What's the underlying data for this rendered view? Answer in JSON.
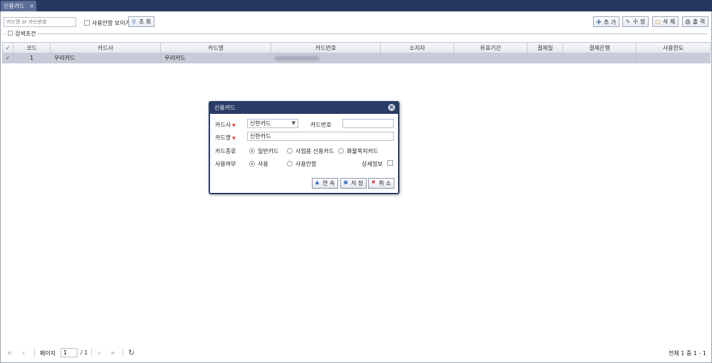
{
  "tab": {
    "label": "신용카드",
    "close": "×"
  },
  "toolbar": {
    "search_placeholder": "카드명 or 카드번호",
    "show_unused_label": "사용안함 보이기",
    "search_button": "조 회",
    "add_button": "추 가",
    "edit_button": "수 정",
    "delete_button": "삭 제",
    "print_button": "출 력"
  },
  "search_conditions": {
    "label": "검색조건"
  },
  "grid": {
    "columns": [
      "코드",
      "카드사",
      "카드명",
      "카드번호",
      "소지자",
      "유효기간",
      "결제일",
      "결제은행",
      "사용한도"
    ],
    "rows": [
      {
        "code": "1",
        "company": "우리카드",
        "name": "우리카드",
        "number": "",
        "holder": "",
        "expiry": "",
        "pay_day": "",
        "bank": "",
        "limit": ""
      }
    ]
  },
  "pager": {
    "page_label": "페이지",
    "page_value": "1",
    "total_pages": "/ 1",
    "summary": "전체 1 중 1 - 1"
  },
  "dialog": {
    "title": "신용카드",
    "company_label": "카드사",
    "company_value": "신한카드",
    "number_label": "카드번호",
    "number_value": "",
    "name_label": "카드명",
    "name_value": "신한카드",
    "type_label": "카드종류",
    "type_options": [
      "일반카드",
      "사업용 신용카드",
      "화물복지카드"
    ],
    "usage_label": "사용여부",
    "usage_options": [
      "사용",
      "사용안함"
    ],
    "detail_label": "상세정보",
    "continue_button": "연 속",
    "save_button": "저 장",
    "cancel_button": "취 소"
  }
}
